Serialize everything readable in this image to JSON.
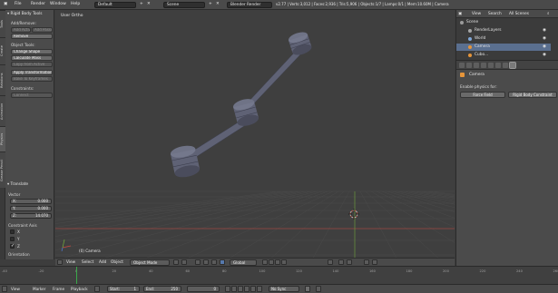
{
  "topbar": {
    "file": "File",
    "render": "Render",
    "window": "Window",
    "help": "Help",
    "layout": "Default",
    "scene": "Scene",
    "engine": "Blender Render",
    "stats": "v2.77 | Verts:3,012 | Faces:2,936 | Tris:5,906 | Objects:1/7 | Lamps:0/1 | Mem:10.60M | Camera"
  },
  "vtabs": [
    "Tools",
    "Create",
    "Relations",
    "Animation",
    "Physics",
    "Grease Pencil"
  ],
  "toolshelf": {
    "header": "Rigid Body Tools",
    "add_remove_label": "Add/Remove:",
    "add_active": "Add Active",
    "add_passive": "Add Passive",
    "remove": "Remove",
    "object_tools_label": "Object Tools:",
    "change_shape": "Change Shape",
    "calculate_mass": "Calculate Mass",
    "copy_from_active": "Copy from Active",
    "apply_transformation": "Apply Transformation",
    "bake_to_keyframes": "Bake To Keyframes",
    "constraints_label": "Constraints:",
    "connect": "Connect",
    "translate_header": "Translate",
    "vector_label": "Vector",
    "x_label": "X:",
    "x_value": "0.000",
    "y_label": "Y:",
    "y_value": "0.000",
    "z_label": "Z:",
    "z_value": "14.070",
    "constraint_axis_label": "Constraint Axis",
    "axis_x": "X",
    "axis_y": "Y",
    "axis_z": "Z",
    "axis_x_checked": false,
    "axis_y_checked": false,
    "axis_z_checked": true,
    "orientation_label": "Orientation"
  },
  "viewport": {
    "title": "User Ortho",
    "object_label": "(0) Camera"
  },
  "viewport_header": {
    "view": "View",
    "select": "Select",
    "add": "Add",
    "object": "Object",
    "mode": "Object Mode",
    "orientation": "Global"
  },
  "timeline": {
    "ticks": [
      "-40",
      "-20",
      "0",
      "20",
      "40",
      "60",
      "80",
      "100",
      "120",
      "140",
      "160",
      "180",
      "200",
      "220",
      "240",
      "260"
    ],
    "current_frame": 0
  },
  "bottombar": {
    "view": "View",
    "marker": "Marker",
    "frame": "Frame",
    "playback": "Playback",
    "start_label": "Start:",
    "start_value": "1",
    "end_label": "End:",
    "end_value": "250",
    "current": "0",
    "sync": "No Sync"
  },
  "outliner": {
    "view": "View",
    "search": "Search",
    "filter": "All Scenes",
    "rows": [
      {
        "label": "Scene",
        "indent": 0,
        "selected": false,
        "color": "#9b9b9b"
      },
      {
        "label": "RenderLayers",
        "indent": 1,
        "selected": false,
        "color": "#a7a7a7"
      },
      {
        "label": "World",
        "indent": 1,
        "selected": false,
        "color": "#7fa6d6"
      },
      {
        "label": "Camera",
        "indent": 1,
        "selected": true,
        "color": "#e6953a"
      },
      {
        "label": "Cubo...",
        "indent": 1,
        "selected": false,
        "color": "#e6953a"
      }
    ]
  },
  "properties": {
    "object_name": "Camera",
    "enable_physics_label": "Enable physics for:",
    "force_field": "Force Field",
    "rigid_body_constraint": "Rigid Body Constraint"
  },
  "colors": {
    "viewport_bg": "#3f3f3f",
    "grid_line": "#4a4a4a",
    "axis_x": "#c8473f",
    "axis_y": "#6fa33a",
    "mesh_fill": "#5f6275",
    "mesh_shade": "#4a4c5c",
    "mesh_light": "#8a8da3",
    "playhead": "#3aa84a",
    "selected_row": "#5a6f8f"
  }
}
